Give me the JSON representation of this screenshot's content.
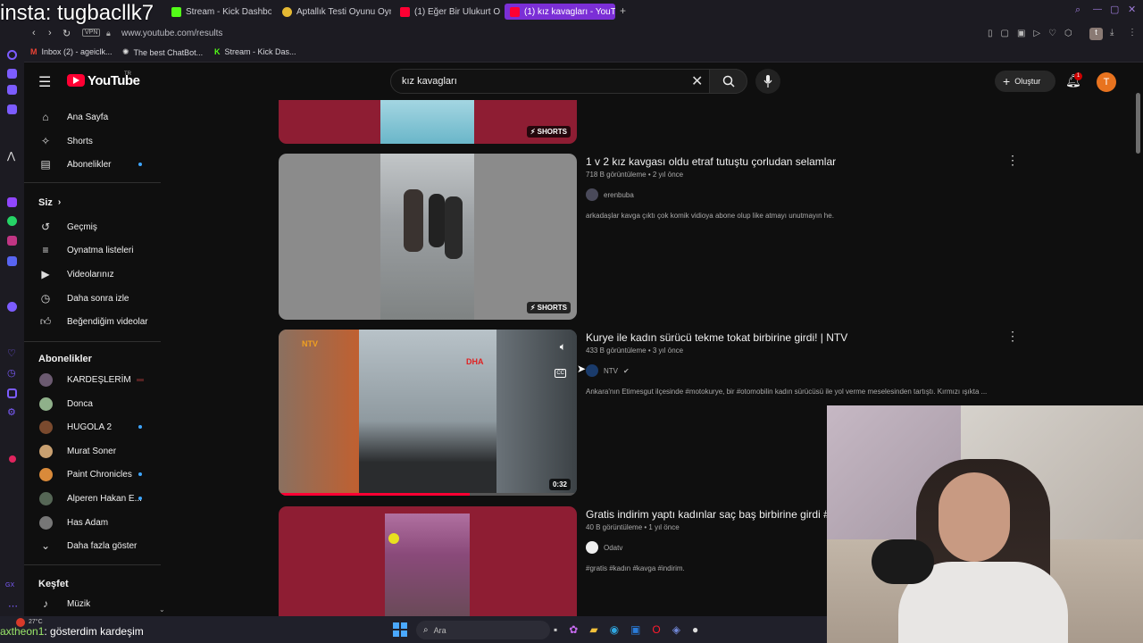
{
  "overlay_text": "insta: tugbacllk7",
  "browser": {
    "tabs": [
      {
        "label": "Stream - Kick Dashboard",
        "active": false
      },
      {
        "label": "Aptallık Testi Oyunu Oyna",
        "active": false
      },
      {
        "label": "(1) Eğer Bir Ulukurt Olarak",
        "active": false
      },
      {
        "label": "(1) kız kavagları - YouTube",
        "active": true
      }
    ],
    "url": "www.youtube.com/results",
    "vpn_label": "VPN",
    "bookmarks": [
      "Inbox (2) - ageiclk...",
      "The best ChatBot...",
      "Stream - Kick Das..."
    ]
  },
  "youtube": {
    "logo_text": "YouTube",
    "logo_country": "TR",
    "search_value": "kız kavagları",
    "create_label": "Oluştur",
    "notification_count": "1",
    "avatar_letter": "T"
  },
  "sidebar": {
    "main": [
      {
        "label": "Ana Sayfa",
        "icon": "home-icon"
      },
      {
        "label": "Shorts",
        "icon": "shorts-icon"
      },
      {
        "label": "Abonelikler",
        "icon": "subscriptions-icon"
      }
    ],
    "you_heading": "Siz",
    "you": [
      {
        "label": "Geçmiş",
        "icon": "history-icon"
      },
      {
        "label": "Oynatma listeleri",
        "icon": "playlist-icon"
      },
      {
        "label": "Videolarınız",
        "icon": "your-videos-icon"
      },
      {
        "label": "Daha sonra izle",
        "icon": "watch-later-icon"
      },
      {
        "label": "Beğendiğim videolar",
        "icon": "like-icon"
      }
    ],
    "subs_heading": "Abonelikler",
    "subs": [
      {
        "label": "KARDEŞLERİM",
        "color": "#6b5a70",
        "indicator": "live"
      },
      {
        "label": "Donca",
        "color": "#8fb08a",
        "indicator": "none"
      },
      {
        "label": "HUGOLA 2",
        "color": "#7a4a2e",
        "indicator": "dot"
      },
      {
        "label": "Murat Soner",
        "color": "#c9a070",
        "indicator": "none"
      },
      {
        "label": "Paint Chronicles",
        "color": "#d98a3a",
        "indicator": "dot"
      },
      {
        "label": "Alperen Hakan E...",
        "color": "#556655",
        "indicator": "dot"
      },
      {
        "label": "Has Adam",
        "color": "#777777",
        "indicator": "none"
      }
    ],
    "show_more": "Daha fazla göster",
    "explore_heading": "Keşfet",
    "explore": [
      {
        "label": "Müzik",
        "icon": "music-icon"
      }
    ]
  },
  "results": [
    {
      "title": "",
      "badge": "SHORTS"
    },
    {
      "title": "1 v 2 kız kavgası oldu etraf tutuştu çorludan selamlar",
      "meta": "718 B görüntüleme • 2 yıl önce",
      "channel": "erenbuba",
      "desc": "arkadaşlar kavga çıktı çok komik vidioya abone olup like atmayı unutmayın he.",
      "badge": "SHORTS"
    },
    {
      "title": "Kurye ile kadın sürücü tekme tokat birbirine girdi! | NTV",
      "meta": "433 B görüntüleme • 3 yıl önce",
      "channel": "NTV",
      "desc": "Ankara'nın Etimesgut ilçesinde #motokurye, bir #otomobilin kadın sürücüsü ile yol verme meselesinden tartıştı. Kırmızı ışıkta ...",
      "duration": "0:32",
      "thumb_logo_left": "NTV",
      "thumb_logo_right": "DHA",
      "cc": "CC",
      "progress": 0.64
    },
    {
      "title": "Gratis indirim yaptı kadınlar saç baş birbirine girdi #",
      "meta": "40 B görüntüleme • 1 yıl önce",
      "channel": "Odatv",
      "desc": "#gratis #kadın #kavga #indirim."
    }
  ],
  "taskbar": {
    "search_placeholder": "Ara",
    "weather": "27°C",
    "chat_user": "axtheon1",
    "chat_message": ": gösterdim kardeşim"
  }
}
